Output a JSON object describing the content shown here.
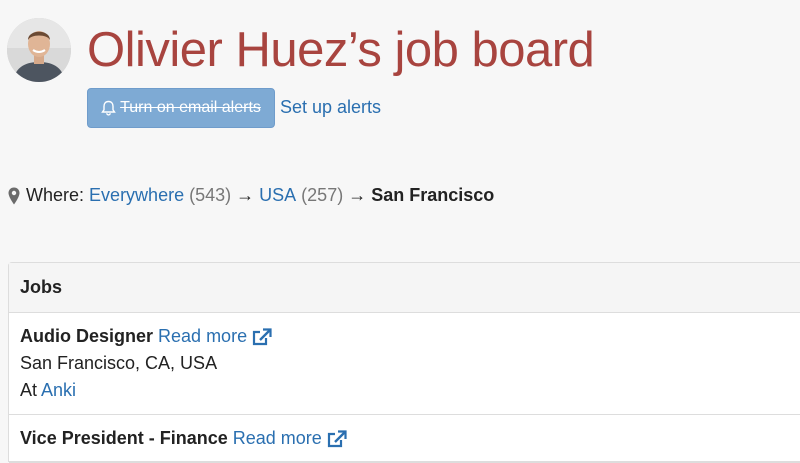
{
  "header": {
    "title": "Olivier Huez’s job board",
    "alert_button_label": "Turn on email alerts",
    "setup_alerts_label": "Set up alerts",
    "avatar_icon": "user-photo",
    "bell_icon": "bell-icon"
  },
  "where": {
    "label": "Where:",
    "crumbs": [
      {
        "label": "Everywhere",
        "count": "(543)"
      },
      {
        "label": "USA",
        "count": "(257)"
      }
    ],
    "arrow": "→",
    "current": "San Francisco",
    "pin_icon": "map-marker-icon"
  },
  "jobs": {
    "heading": "Jobs",
    "read_more_label": "Read more",
    "items": [
      {
        "title": "Audio Designer",
        "location": "San Francisco, CA, USA",
        "at_label": "At",
        "company": "Anki"
      },
      {
        "title": "Vice President - Finance"
      }
    ]
  },
  "colors": {
    "title": "#a8443f",
    "link": "#2a6fb0",
    "button": "#7eaad4"
  }
}
